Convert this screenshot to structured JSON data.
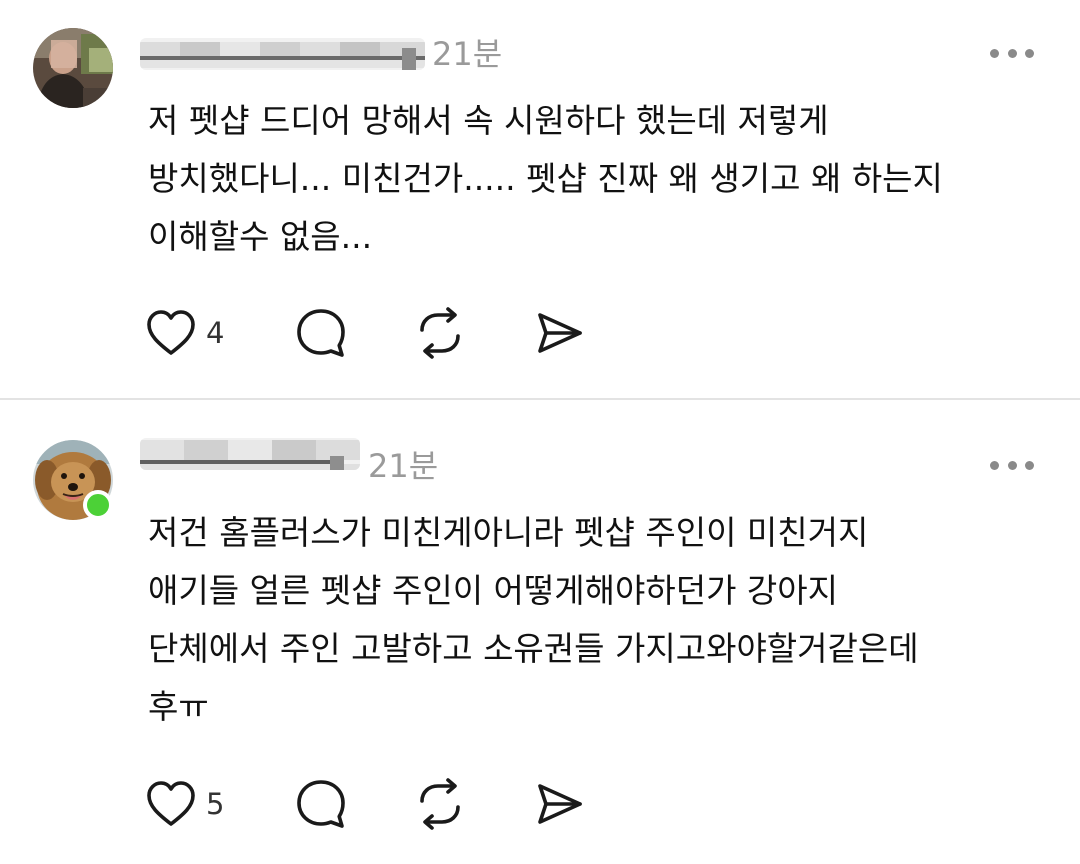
{
  "posts": [
    {
      "time": "21분",
      "lines": [
        "저 펫샵 드디어 망해서 속 시원하다 했는데 저렇게",
        "방치했다니... 미친건가..... 펫샵 진짜 왜 생기고 왜 하는지",
        "이해할수 없음..."
      ],
      "like_count": "4",
      "online": false
    },
    {
      "time": "21분",
      "lines": [
        "저건 홈플러스가 미친게아니라 펫샵 주인이 미친거지",
        "애기들 얼른 펫샵 주인이 어떻게해야하던가 강아지",
        "단체에서 주인 고발하고 소유권들 가지고와야할거같은데",
        "후ㅠ"
      ],
      "like_count": "5",
      "online": true
    }
  ],
  "icons": {
    "like": "heart-icon",
    "reply": "comment-bubble-icon",
    "repost": "repost-icon",
    "share": "send-icon",
    "more": "more-dots-icon"
  },
  "colors": {
    "online_dot": "#4cd137",
    "time_text": "#9a9a9a",
    "divider": "#e3e3e3"
  }
}
